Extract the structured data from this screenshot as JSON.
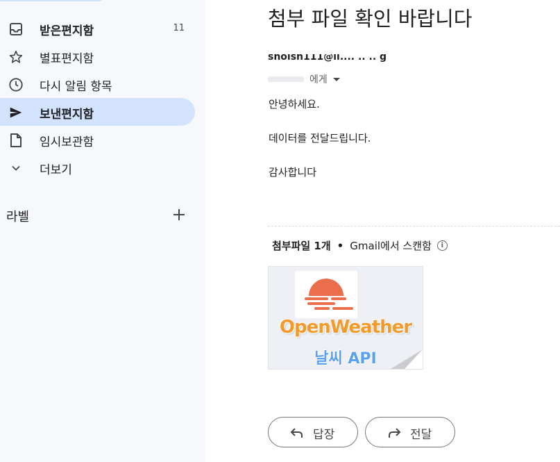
{
  "sidebar": {
    "items": [
      {
        "id": "inbox",
        "label": "받은편지함",
        "count": "11",
        "icon": "inbox-icon",
        "bold": true,
        "active": false
      },
      {
        "id": "starred",
        "label": "별표편지함",
        "count": "",
        "icon": "star-icon",
        "bold": false,
        "active": false
      },
      {
        "id": "snoozed",
        "label": "다시 알림 항목",
        "count": "",
        "icon": "clock-icon",
        "bold": false,
        "active": false
      },
      {
        "id": "sent",
        "label": "보낸편지함",
        "count": "",
        "icon": "send-icon",
        "bold": true,
        "active": true
      },
      {
        "id": "drafts",
        "label": "임시보관함",
        "count": "",
        "icon": "draft-icon",
        "bold": false,
        "active": false
      },
      {
        "id": "more",
        "label": "더보기",
        "count": "",
        "icon": "chevron-down-icon",
        "bold": false,
        "active": false
      }
    ],
    "labels_title": "라벨",
    "labels_add_icon": "plus-icon",
    "active_color": "#d3e3fd",
    "background": "#f6f8fc"
  },
  "message": {
    "subject": "첨부 파일 확인 바랍니다",
    "sender_partial": "shoish111@ll.... .. .. g",
    "recipient_suffix": "에게",
    "body": [
      "안녕하세요.",
      "데이터를 전달드립니다.",
      "감사합니다"
    ]
  },
  "attachments": {
    "count_label": "첨부파일 1개",
    "separator": "•",
    "scan_label": "Gmail에서 스캔함",
    "info_icon": "info-icon",
    "items": [
      {
        "brand_line1": "OpenWeather",
        "brand_line2": "날씨 API",
        "icon": "sun-logo-icon"
      }
    ]
  },
  "actions": {
    "reply_label": "답장",
    "forward_label": "전달"
  },
  "colors": {
    "sun_orange": "#ea6e4b",
    "brand_orange": "#f39a2c",
    "brand_blue": "#5aa2ef"
  }
}
